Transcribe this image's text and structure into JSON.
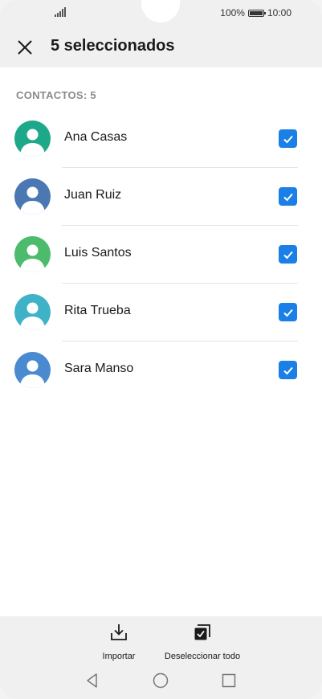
{
  "status_bar": {
    "battery_percent": "100%",
    "time": "10:00"
  },
  "header": {
    "title": "5 seleccionados",
    "close_icon": "close-icon"
  },
  "section": {
    "label": "CONTACTOS: 5"
  },
  "contacts": [
    {
      "name": "Ana Casas",
      "avatar_color": "#1ea88a",
      "checked": true
    },
    {
      "name": "Juan Ruiz",
      "avatar_color": "#4b78b3",
      "checked": true
    },
    {
      "name": "Luis Santos",
      "avatar_color": "#4dbb6c",
      "checked": true
    },
    {
      "name": "Rita Trueba",
      "avatar_color": "#3fb2c8",
      "checked": true
    },
    {
      "name": "Sara Manso",
      "avatar_color": "#4a8ad0",
      "checked": true
    }
  ],
  "actions": {
    "import_label": "Importar",
    "deselect_label": "Deseleccionar todo"
  },
  "colors": {
    "accent": "#1a7fe6",
    "background": "#f0f0f0"
  }
}
